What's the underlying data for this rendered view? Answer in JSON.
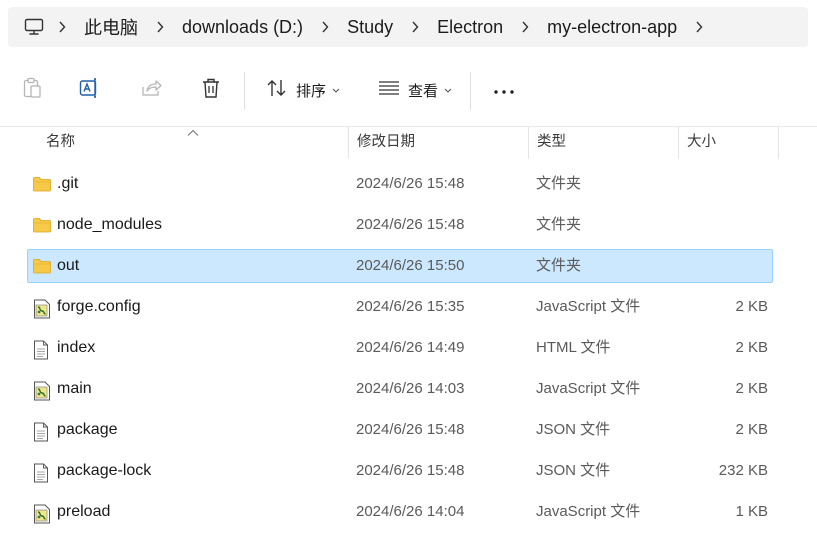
{
  "breadcrumbs": [
    "此电脑",
    "downloads (D:)",
    "Study",
    "Electron",
    "my-electron-app"
  ],
  "toolbar": {
    "sort_label": "排序",
    "view_label": "查看"
  },
  "columns": {
    "name": "名称",
    "date": "修改日期",
    "type": "类型",
    "size": "大小"
  },
  "files": [
    {
      "name": ".git",
      "date": "2024/6/26 15:48",
      "type": "文件夹",
      "size": "",
      "icon": "folder-icon",
      "selected": false
    },
    {
      "name": "node_modules",
      "date": "2024/6/26 15:48",
      "type": "文件夹",
      "size": "",
      "icon": "folder-icon",
      "selected": false
    },
    {
      "name": "out",
      "date": "2024/6/26 15:50",
      "type": "文件夹",
      "size": "",
      "icon": "folder-icon",
      "selected": true
    },
    {
      "name": "forge.config",
      "date": "2024/6/26 15:35",
      "type": "JavaScript 文件",
      "size": "2 KB",
      "icon": "js-file-icon",
      "selected": false
    },
    {
      "name": "index",
      "date": "2024/6/26 14:49",
      "type": "HTML 文件",
      "size": "2 KB",
      "icon": "document-icon",
      "selected": false
    },
    {
      "name": "main",
      "date": "2024/6/26 14:03",
      "type": "JavaScript 文件",
      "size": "2 KB",
      "icon": "js-file-icon",
      "selected": false
    },
    {
      "name": "package",
      "date": "2024/6/26 15:48",
      "type": "JSON 文件",
      "size": "2 KB",
      "icon": "document-icon",
      "selected": false
    },
    {
      "name": "package-lock",
      "date": "2024/6/26 15:48",
      "type": "JSON 文件",
      "size": "232 KB",
      "icon": "document-icon",
      "selected": false
    },
    {
      "name": "preload",
      "date": "2024/6/26 14:04",
      "type": "JavaScript 文件",
      "size": "1 KB",
      "icon": "js-file-icon",
      "selected": false
    }
  ],
  "colors": {
    "selection_bg": "#cce8ff",
    "selection_border": "#99d1ff",
    "folder": "#f7c948"
  }
}
